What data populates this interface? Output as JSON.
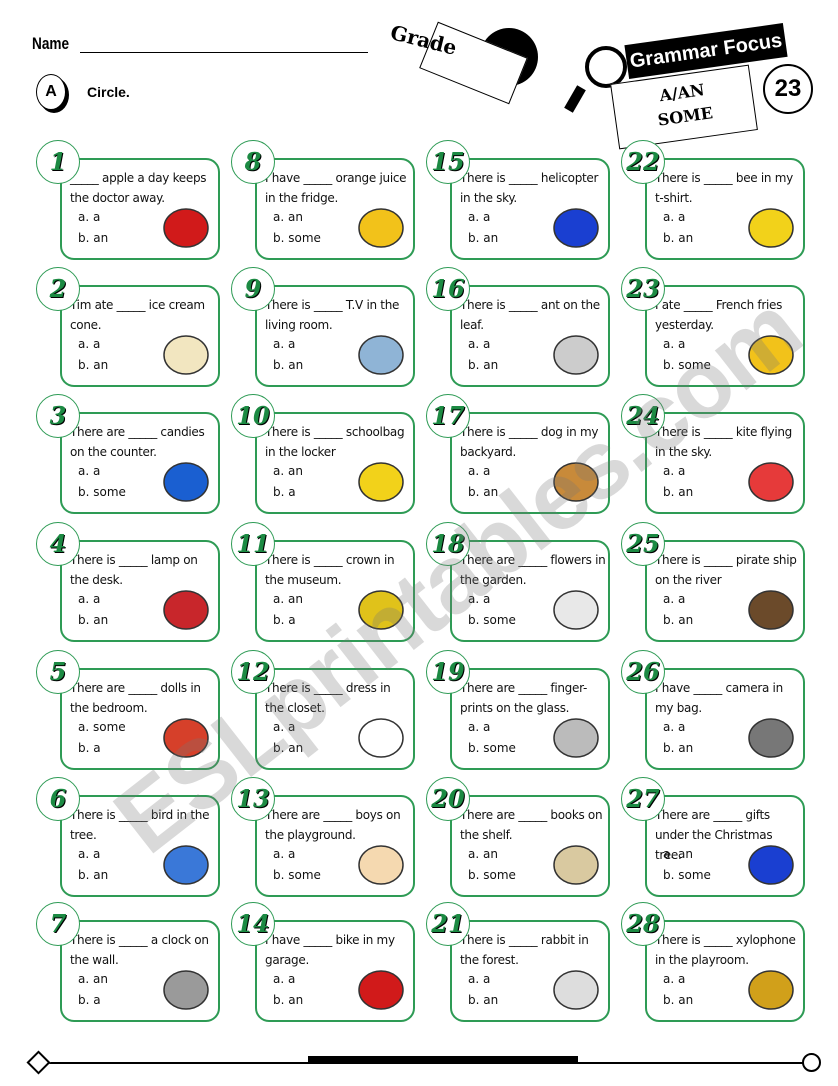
{
  "header": {
    "name_label": "Name",
    "grade_label": "Grade",
    "section_letter": "A",
    "instruction": "Circle.",
    "banner_title": "Grammar Focus",
    "topic_line1": "A/AN",
    "topic_line2": "SOME",
    "worksheet_number": "23"
  },
  "watermark": "ESLprintables.com",
  "colors": {
    "card_border": "#2e9b55",
    "badge_number": "#1c8a43"
  },
  "items": [
    {
      "num": "1",
      "text": "_____ apple a day keeps the doctor away.",
      "a": "a. a",
      "b": "b. an",
      "picture": "apple",
      "color": "#d11a1a"
    },
    {
      "num": "2",
      "text": "Tim ate _____ ice cream cone.",
      "a": "a. a",
      "b": "b. an",
      "picture": "ice-cream-cone",
      "color": "#f2e6c0"
    },
    {
      "num": "3",
      "text": "There are _____ candies on the counter.",
      "a": "a. a",
      "b": "b. some",
      "picture": "candy",
      "color": "#1a5fd1"
    },
    {
      "num": "4",
      "text": "There is _____ lamp on the desk.",
      "a": "a. a",
      "b": "b. an",
      "picture": "lamp",
      "color": "#c8262b"
    },
    {
      "num": "5",
      "text": "There are _____ dolls in the bedroom.",
      "a": "a. some",
      "b": "b. a",
      "picture": "doll",
      "color": "#d6402a"
    },
    {
      "num": "6",
      "text": "There is _____ bird in the tree.",
      "a": "a. a",
      "b": "b. an",
      "picture": "bird",
      "color": "#3a78d8"
    },
    {
      "num": "7",
      "text": "There is _____ a clock on the wall.",
      "a": "a. an",
      "b": "b. a",
      "picture": "clock",
      "color": "#9a9a9a"
    },
    {
      "num": "8",
      "text": "I have _____ orange juice in the fridge.",
      "a": "a. an",
      "b": "b. some",
      "picture": "juice-box",
      "color": "#f2c21a"
    },
    {
      "num": "9",
      "text": "There is _____ T.V in the living room.",
      "a": "a. a",
      "b": "b. an",
      "picture": "tv",
      "color": "#8fb4d6"
    },
    {
      "num": "10",
      "text": "There is _____ schoolbag in the locker",
      "a": "a. an",
      "b": "b. a",
      "picture": "schoolbag",
      "color": "#f2d21a"
    },
    {
      "num": "11",
      "text": "There is _____ crown in the museum.",
      "a": "a. an",
      "b": "b. a",
      "picture": "crown",
      "color": "#e0c21a"
    },
    {
      "num": "12",
      "text": "There is _____ dress in the closet.",
      "a": "a. a",
      "b": "b. an",
      "picture": "dress",
      "color": "#ffffff"
    },
    {
      "num": "13",
      "text": "There are _____ boys on the playground.",
      "a": "a. a",
      "b": "b. some",
      "picture": "boy",
      "color": "#f5d9b0"
    },
    {
      "num": "14",
      "text": "I have _____ bike in my garage.",
      "a": "a. a",
      "b": "b. an",
      "picture": "bike",
      "color": "#d11a1a"
    },
    {
      "num": "15",
      "text": "There is _____ helicopter in the sky.",
      "a": "a. a",
      "b": "b. an",
      "picture": "helicopter",
      "color": "#1a3fd1"
    },
    {
      "num": "16",
      "text": "There is _____ ant on the leaf.",
      "a": "a. a",
      "b": "b. an",
      "picture": "ant",
      "color": "#cccccc"
    },
    {
      "num": "17",
      "text": "There is _____ dog in my backyard.",
      "a": "a. a",
      "b": "b. an",
      "picture": "dog",
      "color": "#c88a3a"
    },
    {
      "num": "18",
      "text": "There are _____ flowers in the garden.",
      "a": "a. a",
      "b": "b. some",
      "picture": "flowers",
      "color": "#e8e8e8"
    },
    {
      "num": "19",
      "text": "There are _____ finger-prints on the glass.",
      "a": "a. a",
      "b": "b. some",
      "picture": "fingerprint",
      "color": "#bbbbbb"
    },
    {
      "num": "20",
      "text": "There are _____ books on the shelf.",
      "a": "a. an",
      "b": "b. some",
      "picture": "book",
      "color": "#d9c9a0"
    },
    {
      "num": "21",
      "text": "There is _____ rabbit in the forest.",
      "a": "a. a",
      "b": "b. an",
      "picture": "rabbit",
      "color": "#dddddd"
    },
    {
      "num": "22",
      "text": "There is _____ bee in my t-shirt.",
      "a": "a. a",
      "b": "b. an",
      "picture": "bee",
      "color": "#f2d21a"
    },
    {
      "num": "23",
      "text": "I ate _____ French fries yesterday.",
      "a": "a. a",
      "b": "b. some",
      "picture": "french-fries",
      "color": "#f2c21a"
    },
    {
      "num": "24",
      "text": "There is _____ kite flying in the sky.",
      "a": "a. a",
      "b": "b. an",
      "picture": "kite",
      "color": "#e63a3a"
    },
    {
      "num": "25",
      "text": "There is _____ pirate ship on the river",
      "a": "a. a",
      "b": "b. an",
      "picture": "pirate-ship",
      "color": "#6b4a2a"
    },
    {
      "num": "26",
      "text": "I have _____ camera in my bag.",
      "a": "a. a",
      "b": "b. an",
      "picture": "camera",
      "color": "#777777"
    },
    {
      "num": "27",
      "text": "There are _____ gifts under the Christmas tree.",
      "a": "a. an",
      "b": "b. some",
      "picture": "gift",
      "color": "#1a3fd1"
    },
    {
      "num": "28",
      "text": "There is _____ xylophone in the playroom.",
      "a": "a. a",
      "b": "b. an",
      "picture": "xylophone",
      "color": "#d1a01a"
    }
  ]
}
